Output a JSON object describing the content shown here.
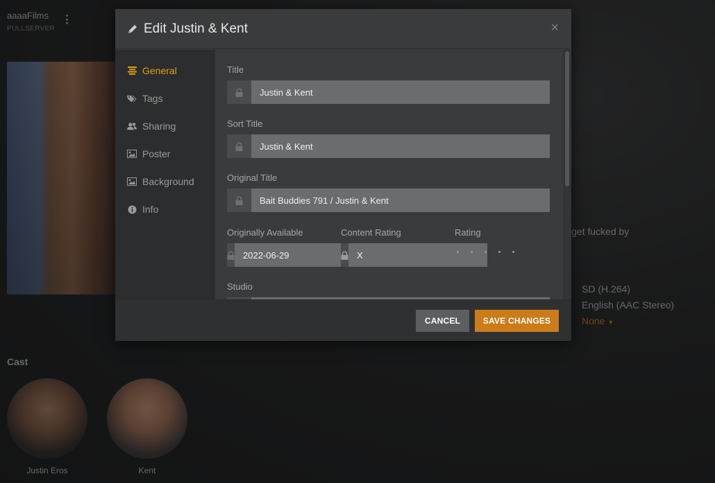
{
  "background": {
    "server_name": "aaaaFilms",
    "server_subtitle": "PULLSERVER",
    "summary_snippet": "get fucked by",
    "video_info": "SD (H.264)",
    "audio_info": "English (AAC Stereo)",
    "subtitle_value": "None",
    "cast_heading": "Cast",
    "cast": [
      {
        "name": "Justin Eros"
      },
      {
        "name": "Kent"
      }
    ]
  },
  "modal": {
    "title": "Edit Justin & Kent",
    "close_glyph": "×",
    "nav": [
      {
        "label": "General",
        "icon": "list-icon",
        "active": true
      },
      {
        "label": "Tags",
        "icon": "tags-icon"
      },
      {
        "label": "Sharing",
        "icon": "users-icon"
      },
      {
        "label": "Poster",
        "icon": "image-icon"
      },
      {
        "label": "Background",
        "icon": "image-icon"
      },
      {
        "label": "Info",
        "icon": "info-icon"
      }
    ],
    "fields": {
      "title": {
        "label": "Title",
        "value": "Justin & Kent"
      },
      "sort_title": {
        "label": "Sort Title",
        "value": "Justin & Kent"
      },
      "original_title": {
        "label": "Original Title",
        "value": "Bait Buddies 791 / Justin & Kent"
      },
      "originally_available": {
        "label": "Originally Available",
        "value": "2022-06-29"
      },
      "content_rating": {
        "label": "Content Rating",
        "value": "X"
      },
      "rating": {
        "label": "Rating",
        "stars": 0,
        "max": 5
      },
      "studio": {
        "label": "Studio",
        "value": ""
      }
    },
    "buttons": {
      "cancel": "CANCEL",
      "save": "SAVE CHANGES"
    }
  },
  "colors": {
    "accent": "#e5a00d",
    "save_button": "#cc7b19"
  }
}
